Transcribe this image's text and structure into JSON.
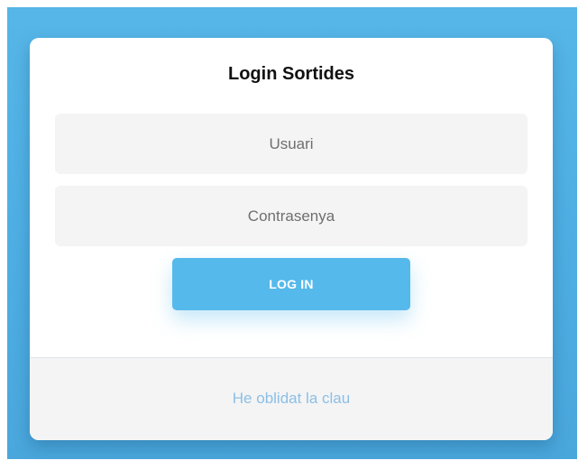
{
  "login": {
    "title": "Login Sortides",
    "username_placeholder": "Usuari",
    "password_placeholder": "Contrasenya",
    "submit_label": "LOG IN",
    "forgot_password_link": "He oblidat la clau"
  },
  "colors": {
    "background": "#4eaee3",
    "card": "#ffffff",
    "input_background": "#f4f4f4",
    "button": "#55b9ec",
    "footer_background": "#f4f4f4",
    "link": "#8bbfe6"
  }
}
